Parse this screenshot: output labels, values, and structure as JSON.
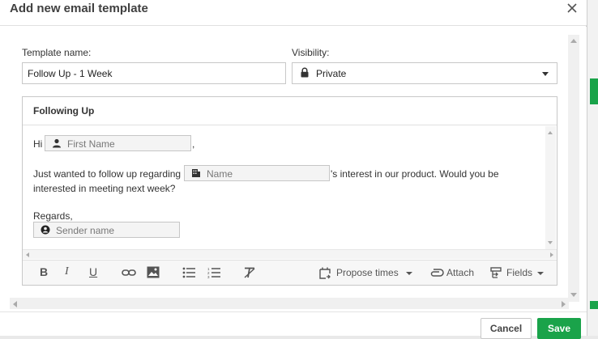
{
  "dialog": {
    "title": "Add new email template",
    "close_icon": "close-icon"
  },
  "form": {
    "template_name_label": "Template name:",
    "template_name_value": "Follow Up - 1 Week",
    "visibility_label": "Visibility:",
    "visibility_value": "Private",
    "visibility_icon": "lock-icon"
  },
  "editor": {
    "subject": "Following Up",
    "line1_prefix": "Hi",
    "line1_suffix": ",",
    "first_name_field": "First Name",
    "line2_prefix": "Just wanted to follow up regarding",
    "name_field": "Name",
    "line2_suffix": "'s interest in our product.  Would you be",
    "line3": "interested in meeting next week?",
    "regards": "Regards,",
    "sender_field": "Sender name"
  },
  "toolbar": {
    "bold": "B",
    "italic": "I",
    "underline": "U",
    "propose_times": "Propose times",
    "attach": "Attach",
    "fields": "Fields"
  },
  "footer": {
    "cancel": "Cancel",
    "save": "Save"
  },
  "colors": {
    "accent": "#1aa34a"
  }
}
